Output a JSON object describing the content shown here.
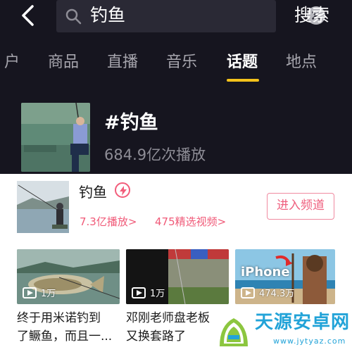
{
  "search": {
    "query": "钓鱼",
    "button_label": "搜索"
  },
  "tabs": [
    {
      "label": "户",
      "active": false
    },
    {
      "label": "商品",
      "active": false
    },
    {
      "label": "直播",
      "active": false
    },
    {
      "label": "音乐",
      "active": false
    },
    {
      "label": "话题",
      "active": true
    },
    {
      "label": "地点",
      "active": false
    }
  ],
  "topic": {
    "title": "#钓鱼",
    "plays": "684.9亿次播放"
  },
  "channel_card": {
    "name": "钓鱼",
    "play_count": "7.3亿播放>",
    "featured_videos": "475精选视频>",
    "enter_button": "进入频道"
  },
  "videos": [
    {
      "views": "1万",
      "caption_line1": "终于用米诺钓到",
      "caption_line2": "了鳜鱼，而且一..."
    },
    {
      "views": "1万",
      "caption_line1": "邓刚老师盘老板",
      "caption_line2": "又换套路了"
    },
    {
      "views": "474.3万",
      "overlay_text": "iPhone"
    }
  ],
  "watermark": {
    "name": "天源安卓网",
    "url": "www.jytyaz.com"
  },
  "colors": {
    "dark_bg": "#16151f",
    "accent_pink": "#f05a78",
    "tab_underline": "#f4c21b",
    "watermark_blue": "#22a3d8"
  }
}
